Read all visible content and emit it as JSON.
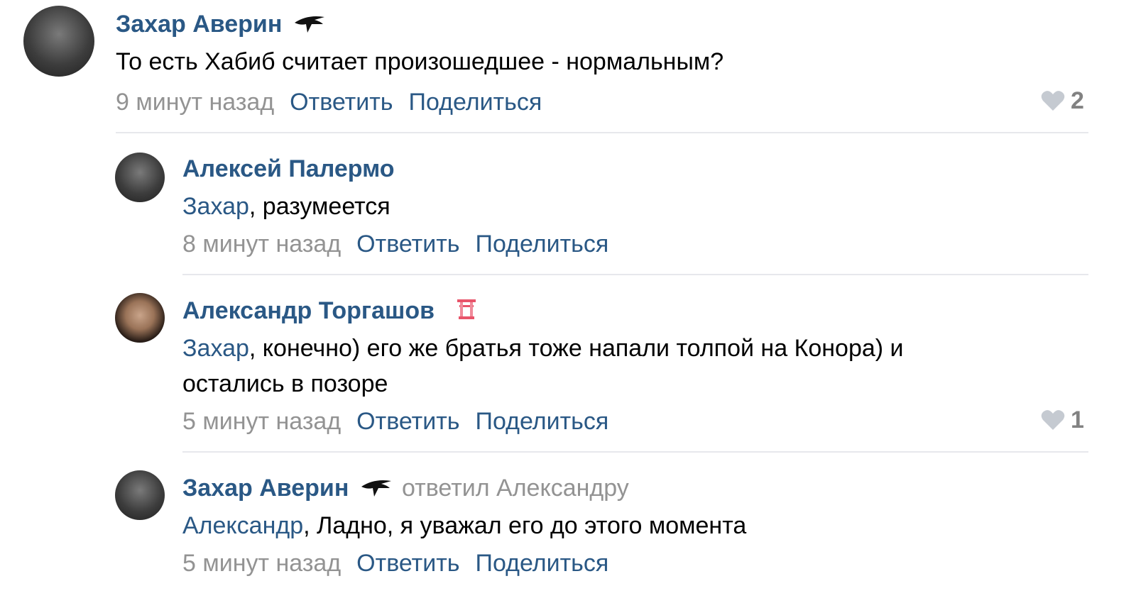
{
  "colors": {
    "link": "#2a5885",
    "meta": "#939393",
    "divider": "#e7e8ec",
    "heart": "#c5cad1"
  },
  "comments": [
    {
      "author": "Захар Аверин",
      "badge_icon": "wing-badge-icon",
      "text": "То есть Хабиб считает произошедшее - нормальным?",
      "time": "9 минут назад",
      "reply": "Ответить",
      "share": "Поделиться",
      "likes": "2"
    },
    {
      "author": "Алексей Палермо",
      "mention": "Захар",
      "text": ", разумеется",
      "time": "8 минут назад",
      "reply": "Ответить",
      "share": "Поделиться"
    },
    {
      "author": "Александр Торгашов",
      "badge_icon": "gate-badge-icon",
      "mention": "Захар",
      "text_line1": ", конечно) его же братья тоже напали толпой на Конора) и",
      "text_line2": "остались в позоре",
      "time": "5 минут назад",
      "reply": "Ответить",
      "share": "Поделиться",
      "likes": "1"
    },
    {
      "author": "Захар Аверин",
      "badge_icon": "wing-badge-icon",
      "replied_to": "ответил Александру",
      "mention": "Александр",
      "text": ", Ладно, я уважал его до этого момента",
      "time": "5 минут назад",
      "reply": "Ответить",
      "share": "Поделиться"
    }
  ]
}
